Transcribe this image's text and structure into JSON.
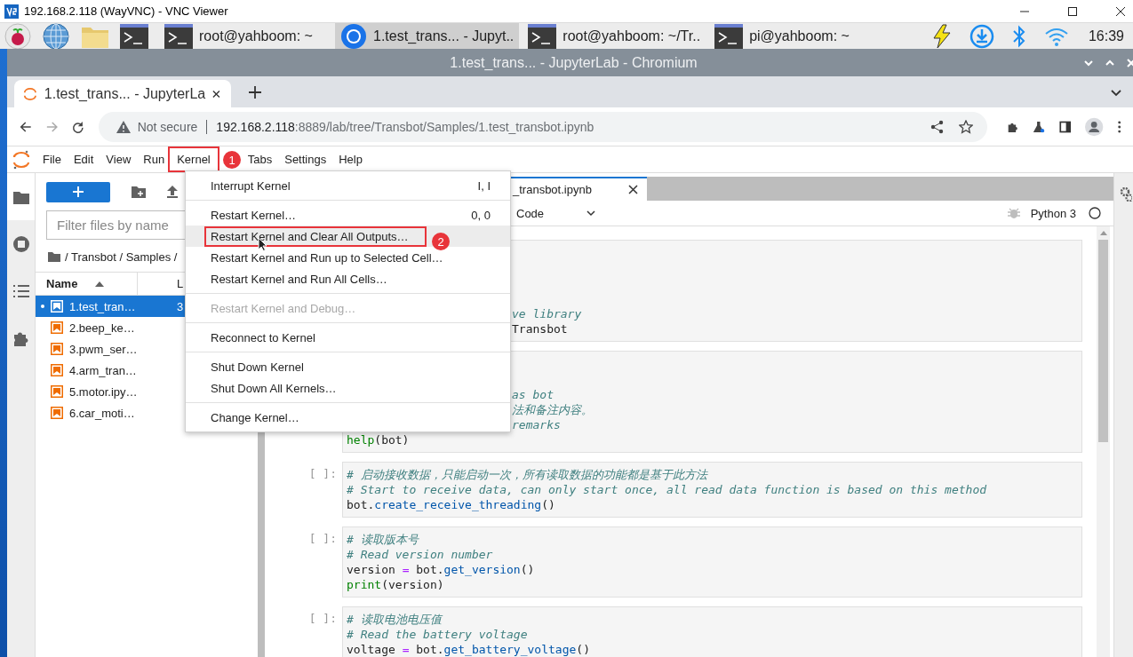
{
  "vnc_window": {
    "title": "192.168.2.118 (WayVNC) - VNC Viewer"
  },
  "taskbar": {
    "tasks": [
      {
        "kind": "terminal",
        "label": "root@yahboom: ~",
        "selected": false
      },
      {
        "kind": "browser",
        "label": "1.test_trans... - Jupyt..",
        "selected": true
      },
      {
        "kind": "terminal",
        "label": "root@yahboom: ~/Tr..",
        "selected": false
      },
      {
        "kind": "terminal",
        "label": "pi@yahboom: ~",
        "selected": false
      }
    ],
    "clock": "16:39"
  },
  "browser": {
    "title": "1.test_trans... - JupyterLab - Chromium",
    "tab": {
      "title": "1.test_trans... - JupyterLa"
    },
    "address": {
      "security": "Not secure",
      "host": "192.168.2.118",
      "path": ":8889/lab/tree/Transbot/Samples/1.test_transbot.ipynb"
    }
  },
  "jupyter": {
    "menu_bar": [
      {
        "label": "File"
      },
      {
        "label": "Edit"
      },
      {
        "label": "View"
      },
      {
        "label": "Run"
      },
      {
        "label": "Kernel",
        "badge": "1"
      },
      {
        "label": "Tabs"
      },
      {
        "label": "Settings"
      },
      {
        "label": "Help"
      }
    ],
    "sidebar_tabs": [
      {
        "kind": "files",
        "selected": true
      },
      {
        "kind": "running",
        "selected": false
      },
      {
        "kind": "toc",
        "selected": false
      },
      {
        "kind": "extensions",
        "selected": false
      }
    ],
    "file_browser": {
      "filter": {
        "placeholder": "Filter files by name"
      },
      "breadcrumb": "/ Transbot / Samples /",
      "columns": [
        "Name",
        "L"
      ],
      "files": [
        {
          "name": "1.test_tran…",
          "modified": "3",
          "selected": true,
          "running": true
        },
        {
          "name": "2.beep_ke…",
          "selected": false,
          "running": false
        },
        {
          "name": "3.pwm_ser…",
          "selected": false,
          "running": false
        },
        {
          "name": "4.arm_tran…",
          "selected": false,
          "running": false
        },
        {
          "name": "5.motor.ipy…",
          "selected": false,
          "running": false
        },
        {
          "name": "6.car_moti…",
          "selected": false,
          "running": false
        }
      ]
    },
    "notebook": {
      "tab": {
        "title": "_transbot.ipynb"
      },
      "cell_type": "Code",
      "kernel": "Python 3",
      "cells": [
        {
          "kind": "covered",
          "lines": [
            {
              "kind": "clipped",
              "tokens": [
                {
                  "kind": "comment",
                  "text": "ve library"
                }
              ]
            },
            {
              "kind": "clipped",
              "tokens": [
                {
                  "kind": "name",
                  "text": "Transbot"
                }
              ]
            }
          ]
        },
        {
          "kind": "covered",
          "lines": [
            {
              "kind": "clipped",
              "tokens": [
                {
                  "kind": "comment",
                  "text": "as bot"
                }
              ]
            },
            {
              "kind": "clipped",
              "tokens": [
                {
                  "kind": "comment",
                  "text": "法和备注内容。"
                }
              ]
            },
            {
              "kind": "clipped",
              "tokens": [
                {
                  "kind": "comment",
                  "text": "remarks"
                }
              ]
            },
            {
              "kind": "code",
              "tokens": [
                {
                  "kind": "builtin",
                  "text": "help"
                },
                {
                  "kind": "name",
                  "text": "(bot)"
                }
              ]
            }
          ]
        },
        {
          "kind": "visible",
          "prompt": "[ ]:",
          "lines": [
            {
              "kind": "code",
              "tokens": [
                {
                  "kind": "comment",
                  "text": "# 启动接收数据，只能启动一次，所有读取数据的功能都是基于此方法"
                }
              ]
            },
            {
              "kind": "code",
              "tokens": [
                {
                  "kind": "comment",
                  "text": "# Start to receive data, can only start once, all read data function is based on this method"
                }
              ]
            },
            {
              "kind": "code",
              "tokens": [
                {
                  "kind": "name",
                  "text": "bot."
                },
                {
                  "kind": "func",
                  "text": "create_receive_threading"
                },
                {
                  "kind": "name",
                  "text": "()"
                }
              ]
            }
          ]
        },
        {
          "kind": "visible",
          "prompt": "[ ]:",
          "lines": [
            {
              "kind": "code",
              "tokens": [
                {
                  "kind": "comment",
                  "text": "# 读取版本号"
                }
              ]
            },
            {
              "kind": "code",
              "tokens": [
                {
                  "kind": "comment",
                  "text": "# Read version number"
                }
              ]
            },
            {
              "kind": "code",
              "tokens": [
                {
                  "kind": "name",
                  "text": "version "
                },
                {
                  "kind": "op",
                  "text": "="
                },
                {
                  "kind": "name",
                  "text": " bot."
                },
                {
                  "kind": "func",
                  "text": "get_version"
                },
                {
                  "kind": "name",
                  "text": "()"
                }
              ]
            },
            {
              "kind": "code",
              "tokens": [
                {
                  "kind": "builtin",
                  "text": "print"
                },
                {
                  "kind": "name",
                  "text": "(version)"
                }
              ]
            }
          ]
        },
        {
          "kind": "visible",
          "prompt": "[ ]:",
          "lines": [
            {
              "kind": "code",
              "tokens": [
                {
                  "kind": "comment",
                  "text": "# 读取电池电压值"
                }
              ]
            },
            {
              "kind": "code",
              "tokens": [
                {
                  "kind": "comment",
                  "text": "# Read the battery voltage"
                }
              ]
            },
            {
              "kind": "code",
              "tokens": [
                {
                  "kind": "name",
                  "text": "voltage "
                },
                {
                  "kind": "op",
                  "text": "="
                },
                {
                  "kind": "name",
                  "text": " bot."
                },
                {
                  "kind": "func",
                  "text": "get_battery_voltage"
                },
                {
                  "kind": "name",
                  "text": "()"
                }
              ]
            }
          ]
        }
      ]
    },
    "kernel_menu": {
      "groups": [
        [
          {
            "label": "Interrupt Kernel",
            "shortcut": "I, I",
            "disabled": false,
            "selected": false
          }
        ],
        [
          {
            "label": "Restart Kernel…",
            "shortcut": "0, 0",
            "disabled": false,
            "selected": false
          },
          {
            "label": "Restart Kernel and Clear All Outputs…",
            "disabled": false,
            "selected": true,
            "badge": "2"
          },
          {
            "label": "Restart Kernel and Run up to Selected Cell…",
            "disabled": false,
            "selected": false
          },
          {
            "label": "Restart Kernel and Run All Cells…",
            "disabled": false,
            "selected": false
          }
        ],
        [
          {
            "label": "Restart Kernel and Debug…",
            "disabled": true,
            "selected": false
          }
        ],
        [
          {
            "label": "Reconnect to Kernel",
            "disabled": false,
            "selected": false
          }
        ],
        [
          {
            "label": "Shut Down Kernel",
            "disabled": false,
            "selected": false
          },
          {
            "label": "Shut Down All Kernels…",
            "disabled": false,
            "selected": false
          }
        ],
        [
          {
            "label": "Change Kernel…",
            "disabled": false,
            "selected": false
          }
        ]
      ]
    }
  }
}
